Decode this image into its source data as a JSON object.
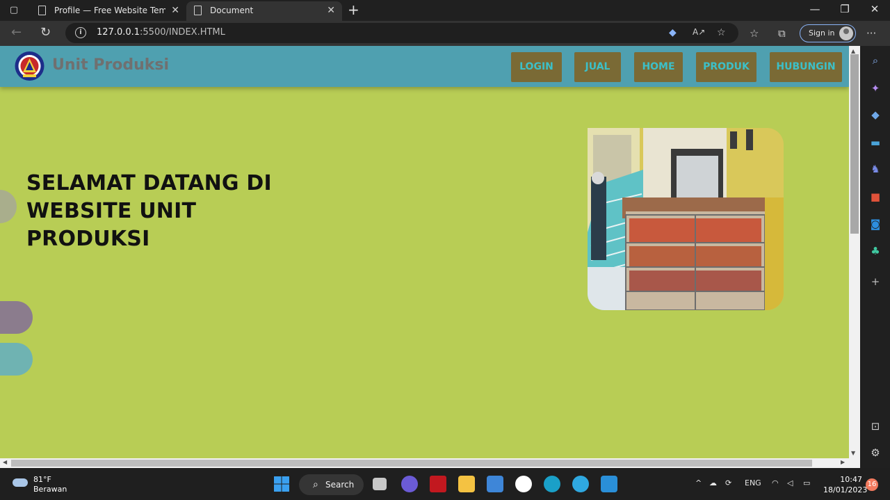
{
  "browser": {
    "tabs": [
      {
        "title": "Profile — Free Website Template",
        "active": false
      },
      {
        "title": "Document",
        "active": true
      }
    ],
    "url": {
      "host": "127.0.0.1",
      "rest": ":5500/INDEX.HTML"
    },
    "sign_in_label": "Sign in"
  },
  "site": {
    "brand": "Unit Produksi",
    "nav": [
      "LOGIN",
      "JUAL",
      "HOME",
      "PRODUK",
      "HUBUNGIN"
    ],
    "hero_title": "SELAMAT DATANG DI WEBSITE UNIT PRODUKSI",
    "colors": {
      "header": "#4fa0b0",
      "page": "#b8cd55",
      "nav_button": "#7a6a35",
      "nav_text": "#3cc0c8"
    }
  },
  "taskbar": {
    "weather_temp": "81°F",
    "weather_desc": "Berawan",
    "search_label": "Search",
    "lang": "ENG",
    "time": "10:47",
    "date": "18/01/2023",
    "notifications": "16"
  }
}
